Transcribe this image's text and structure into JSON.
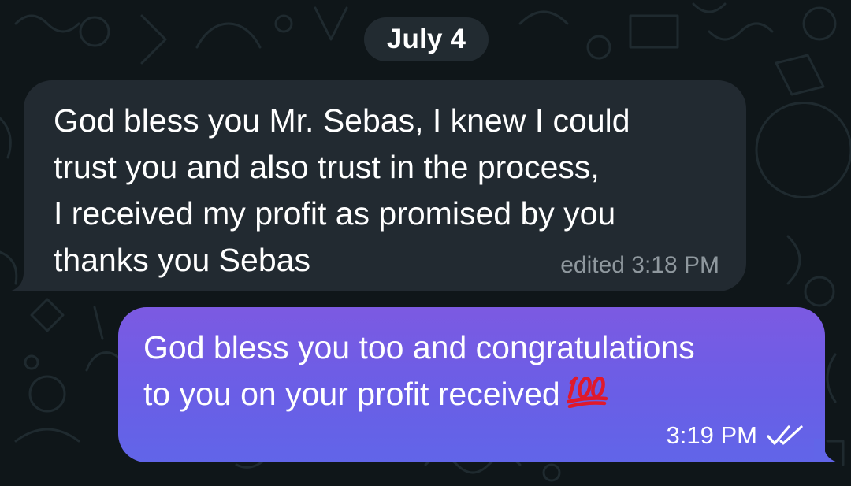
{
  "date_separator": "July 4",
  "messages": [
    {
      "direction": "incoming",
      "text": "God bless you Mr. Sebas, I knew I could\ntrust you and also trust in the process,\nI received my profit as promised by you\nthanks you Sebas",
      "meta": "edited 3:18 PM"
    },
    {
      "direction": "outgoing",
      "text_line1": "God bless you too and congratulations",
      "text_line2": "to you on your profit received",
      "emoji": "hundred-points-emoji",
      "time": "3:19 PM",
      "status_icon": "double-check-icon"
    }
  ],
  "colors": {
    "background": "#0f1619",
    "incoming_bubble": "#222a31",
    "outgoing_bubble_top": "#7c5ae2",
    "outgoing_bubble_bottom": "#6165e8",
    "date_pill": "#222b31",
    "incoming_meta": "#8f989e",
    "emoji_red": "#e0192b"
  }
}
